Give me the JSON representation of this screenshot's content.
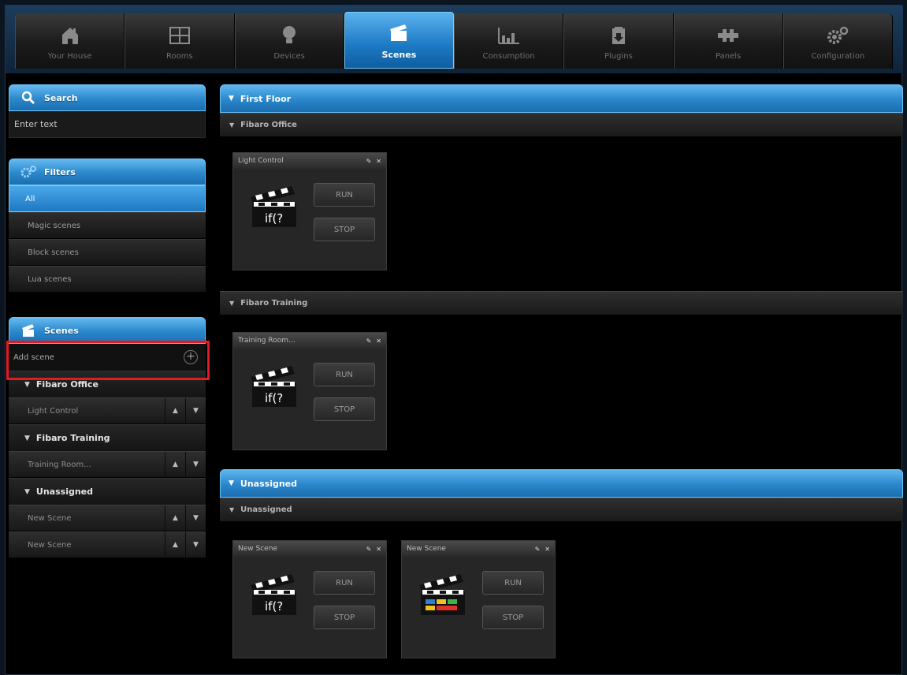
{
  "nav": {
    "items": [
      {
        "label": "Your House",
        "icon": "house-icon"
      },
      {
        "label": "Rooms",
        "icon": "rooms-icon"
      },
      {
        "label": "Devices",
        "icon": "bulb-icon"
      },
      {
        "label": "Scenes",
        "icon": "clapperboard-icon"
      },
      {
        "label": "Consumption",
        "icon": "chart-icon"
      },
      {
        "label": "Plugins",
        "icon": "plugin-icon"
      },
      {
        "label": "Panels",
        "icon": "panels-icon"
      },
      {
        "label": "Configuration",
        "icon": "gears-icon"
      }
    ],
    "active": "Scenes"
  },
  "sidebar": {
    "search": {
      "title": "Search",
      "placeholder": "Enter text"
    },
    "filters": {
      "title": "Filters",
      "items": [
        "All",
        "Magic scenes",
        "Block scenes",
        "Lua scenes"
      ],
      "active": "All"
    },
    "scenes": {
      "title": "Scenes",
      "add_label": "Add scene",
      "groups": [
        {
          "name": "Fibaro Office",
          "items": [
            "Light Control"
          ]
        },
        {
          "name": "Fibaro Training",
          "items": [
            "Training Room..."
          ]
        },
        {
          "name": "Unassigned",
          "items": [
            "New Scene",
            "New Scene"
          ]
        }
      ]
    }
  },
  "main": {
    "sections": [
      {
        "title": "First Floor",
        "rooms": [
          {
            "name": "Fibaro Office",
            "cards": [
              {
                "title": "Light Control",
                "kind": "lua"
              }
            ]
          },
          {
            "name": "Fibaro Training",
            "cards": [
              {
                "title": "Training Room...",
                "kind": "lua"
              }
            ]
          }
        ]
      },
      {
        "title": "Unassigned",
        "rooms": [
          {
            "name": "Unassigned",
            "cards": [
              {
                "title": "New Scene",
                "kind": "lua"
              },
              {
                "title": "New Scene",
                "kind": "block"
              }
            ]
          }
        ]
      }
    ],
    "run_label": "RUN",
    "stop_label": "STOP",
    "lua_text": "if(?"
  },
  "colors": {
    "accent": "#2a86cb",
    "highlight": "#e21a22"
  }
}
